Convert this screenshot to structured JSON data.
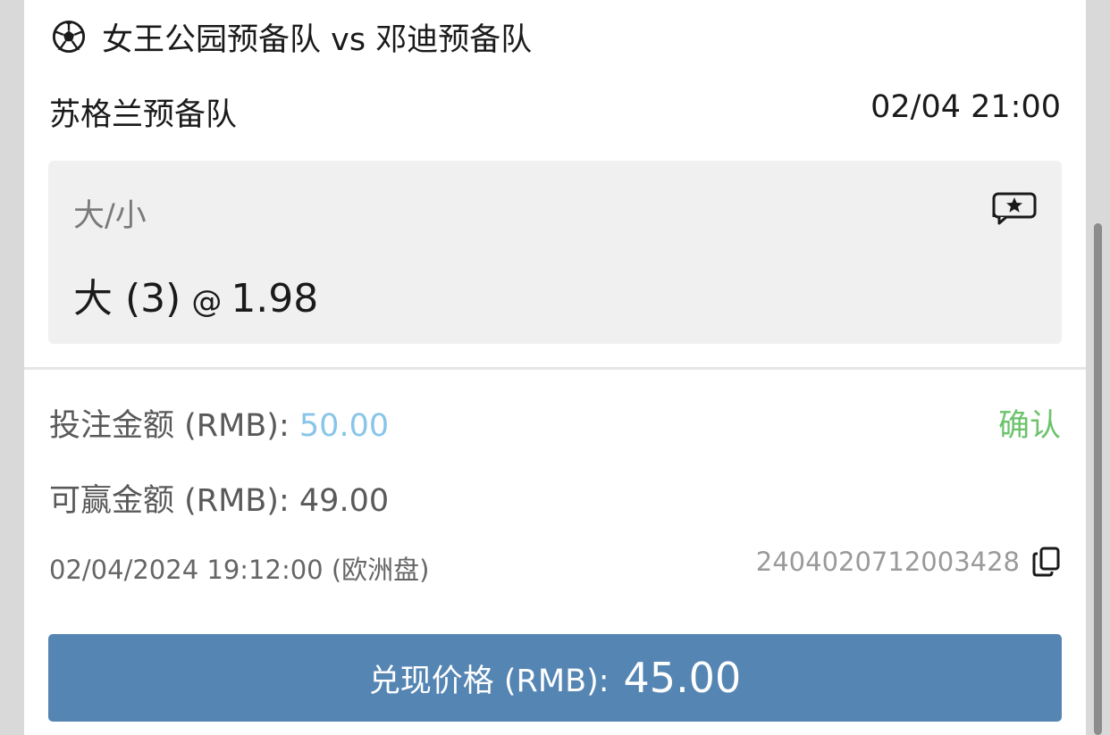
{
  "match": {
    "icon": "soccer-ball-icon",
    "title": "女王公园预备队 vs 邓迪预备队"
  },
  "league": "苏格兰预备队",
  "kickoff": "02/04 21:00",
  "bet": {
    "market": "大/小",
    "selection": "大 (3)",
    "at": "@",
    "odds": "1.98",
    "icon": "chat-star-icon"
  },
  "stake": {
    "label": "投注金额 (RMB):",
    "value": "50.00"
  },
  "confirm_label": "确认",
  "potential_win": {
    "label": "可赢金额 (RMB):",
    "value": "49.00"
  },
  "placed_time": "02/04/2024 19:12:00 (欧洲盘)",
  "ticket_id": "2404020712003428",
  "cashout": {
    "label": "兑现价格 (RMB):",
    "value": "45.00"
  },
  "colors": {
    "cashout_button": "#5585b3",
    "confirm": "#6cc36c",
    "stake_value": "#87c5ea"
  }
}
